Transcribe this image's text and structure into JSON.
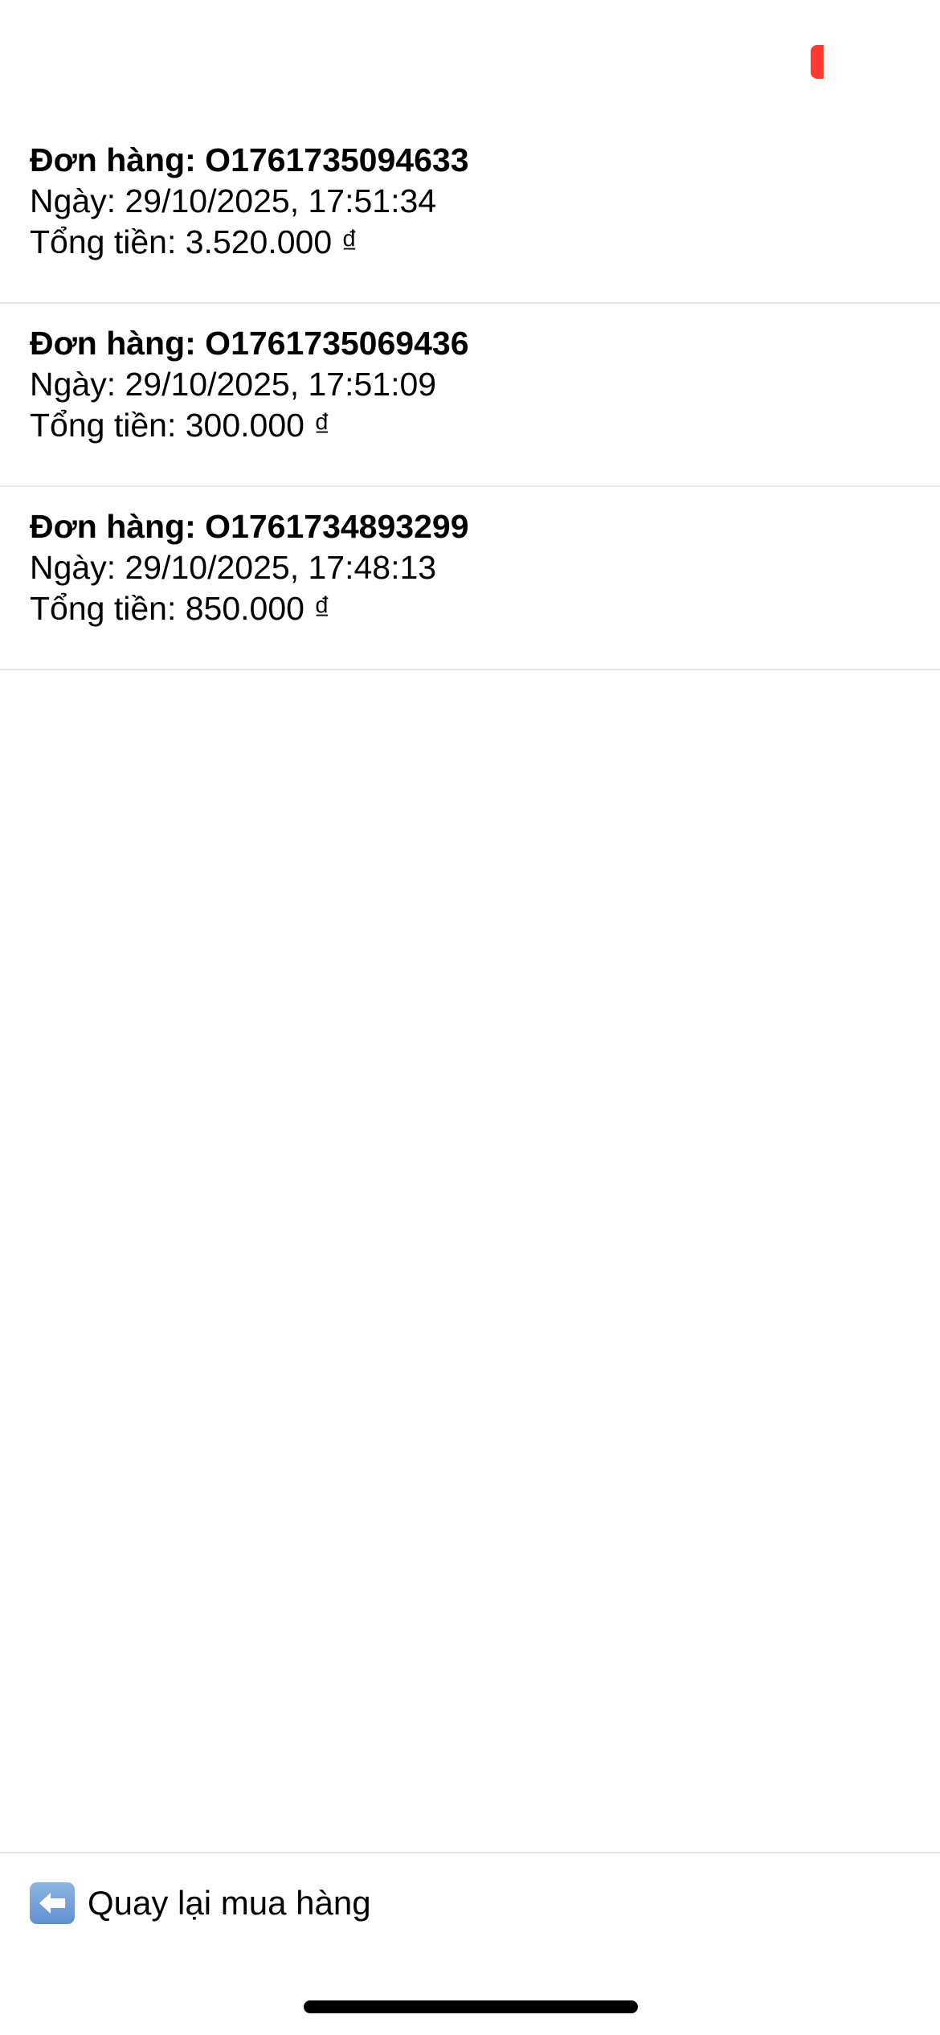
{
  "orders": [
    {
      "id_line": "Đơn hàng: O1761735094633",
      "date_line": "Ngày: 29/10/2025, 17:51:34",
      "total_line": "Tổng tiền: 3.520.000 ₫"
    },
    {
      "id_line": "Đơn hàng: O1761735069436",
      "date_line": "Ngày: 29/10/2025, 17:51:09",
      "total_line": "Tổng tiền: 300.000 ₫"
    },
    {
      "id_line": "Đơn hàng: O1761734893299",
      "date_line": "Ngày: 29/10/2025, 17:48:13",
      "total_line": "Tổng tiền: 850.000 ₫"
    }
  ],
  "footer": {
    "back_label": "Quay lại mua hàng",
    "back_icon": "left-arrow-icon"
  },
  "colors": {
    "indicator": "#ff3b30",
    "divider": "#e4e4e4",
    "back_icon_bg": "#6f9bd6"
  }
}
